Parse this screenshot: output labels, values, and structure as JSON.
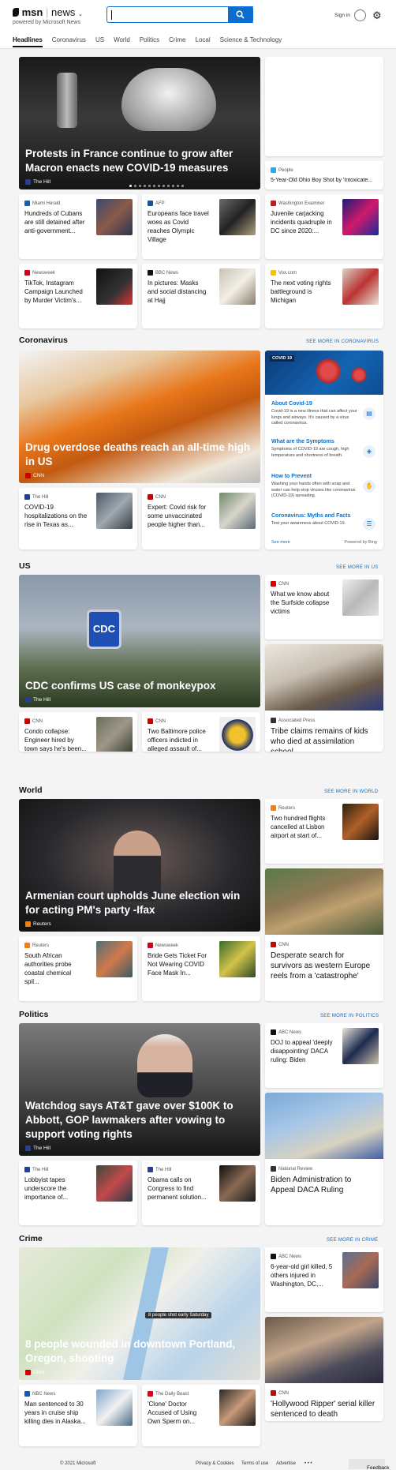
{
  "header": {
    "brand": "msn",
    "section": "news",
    "powered_by": "powered by Microsoft News",
    "sign_in": "Sign in"
  },
  "nav": [
    "Headlines",
    "Coronavirus",
    "US",
    "World",
    "Politics",
    "Crime",
    "Local",
    "Science & Technology"
  ],
  "hero_top": {
    "title": "Protests in France continue to grow after Macron enacts new COVID-19 measures",
    "source": "The Hill"
  },
  "top_right": [
    {
      "source": "People",
      "title": "5-Year-Old Ohio Boy Shot by 'Intoxicate..."
    }
  ],
  "row1": [
    {
      "source": "Miami Herald",
      "title": "Hundreds of Cubans are still detained after anti-government..."
    },
    {
      "source": "AFP",
      "title": "Europeans face travel woes as Covid reaches Olympic Village"
    },
    {
      "source": "Washington Examiner",
      "title": "Juvenile carjacking incidents quadruple in DC since 2020:..."
    }
  ],
  "row2": [
    {
      "source": "Newsweek",
      "title": "TikTok, Instagram Campaign Launched by Murder Victim's..."
    },
    {
      "source": "BBC News",
      "title": "In pictures: Masks and social distancing at Hajj"
    },
    {
      "source": "Vox.com",
      "title": "The next voting rights battleground is Michigan"
    }
  ],
  "coronavirus": {
    "heading": "Coronavirus",
    "more": "SEE MORE IN CORONAVIRUS",
    "hero": {
      "title": "Drug overdose deaths reach an all-time high in US",
      "source": "CNN"
    },
    "cards": [
      {
        "source": "The Hill",
        "title": "COVID-19 hospitalizations on the rise in Texas as..."
      },
      {
        "source": "CNN",
        "title": "Expert: Covid risk for some unvaccinated people higher than..."
      }
    ],
    "widget": {
      "tag": "COVID 19",
      "items": [
        {
          "h": "About Covid-19",
          "d": "Covid-19 is a new illness that can affect your lungs and airways. It's caused by a virus called coronavirus."
        },
        {
          "h": "What are the Symptoms",
          "d": "Symptoms of COVID-19 are cough, high temperature and shortness of breath."
        },
        {
          "h": "How to Prevent",
          "d": "Washing your hands often with soap and water can help stop viruses like coronavirus (COVID-19) spreading."
        },
        {
          "h": "Coronavirus: Myths and Facts",
          "d": "Test your awareness about COVID-19."
        }
      ],
      "see_more": "See more",
      "powered": "Powered by Bing"
    }
  },
  "us": {
    "heading": "US",
    "more": "SEE MORE IN US",
    "hero": {
      "title": "CDC confirms US case of monkeypox",
      "source": "The Hill"
    },
    "right": {
      "source": "CNN",
      "title": "What we know about the Surfside collapse victims"
    },
    "cards": [
      {
        "source": "CNN",
        "title": "Condo collapse: Engineer hired by town says he's been..."
      },
      {
        "source": "CNN",
        "title": "Two Baltimore police officers indicted in alleged assault of..."
      }
    ],
    "tall": {
      "source": "Associated Press",
      "title": "Tribe claims remains of kids who died at assimilation school"
    }
  },
  "world": {
    "heading": "World",
    "more": "SEE MORE IN WORLD",
    "hero": {
      "title": "Armenian court upholds June election win for acting PM's party -Ifax",
      "source": "Reuters"
    },
    "right": {
      "source": "Reuters",
      "title": "Two hundred flights cancelled at Lisbon airport at start of..."
    },
    "cards": [
      {
        "source": "Reuters",
        "title": "South African authorities probe coastal chemical spil..."
      },
      {
        "source": "Newsweek",
        "title": "Bride Gets Ticket For Not Wearing COVID Face Mask In..."
      }
    ],
    "tall": {
      "source": "CNN",
      "title": "Desperate search for survivors as western Europe reels from a 'catastrophe'"
    }
  },
  "politics": {
    "heading": "Politics",
    "more": "SEE MORE IN POLITICS",
    "hero": {
      "title": "Watchdog says AT&T gave over $100K to Abbott, GOP lawmakers after vowing to support voting rights",
      "source": "The Hill"
    },
    "right": {
      "source": "ABC News",
      "title": "DOJ to appeal 'deeply disappointing' DACA ruling: Biden"
    },
    "cards": [
      {
        "source": "The Hill",
        "title": "Lobbyist tapes underscore the importance of..."
      },
      {
        "source": "The Hill",
        "title": "Obama calls on Congress to find permanent solution..."
      }
    ],
    "tall": {
      "source": "National Review",
      "title": "Biden Administration to Appeal DACA Ruling"
    }
  },
  "crime": {
    "heading": "Crime",
    "more": "SEE MORE IN CRIME",
    "hero": {
      "title": "8 people wounded in downtown Portland, Oregon, shooting",
      "source": "CNN",
      "map_label": "8 people shot early Saturday"
    },
    "right": {
      "source": "ABC News",
      "title": "6-year-old girl killed, 5 others injured in Washington, DC,..."
    },
    "cards": [
      {
        "source": "NBC News",
        "title": "Man sentenced to 30 years in cruise ship killing dies in Alaska..."
      },
      {
        "source": "The Daily Beast",
        "title": "'Clone' Doctor Accused of Using Own Sperm on..."
      }
    ],
    "tall": {
      "source": "CNN",
      "title": "'Hollywood Ripper' serial killer sentenced to death"
    }
  },
  "footer": {
    "copyright": "© 2021 Microsoft",
    "privacy": "Privacy & Cookies",
    "terms": "Terms of use",
    "advertise": "Advertise",
    "more": "• • •",
    "feedback": "Feedback"
  },
  "colors": {
    "accent": "#0b6ecf",
    "cnn": "#cc0000",
    "hill": "#2a3d8f",
    "reuters": "#f07f1a"
  }
}
